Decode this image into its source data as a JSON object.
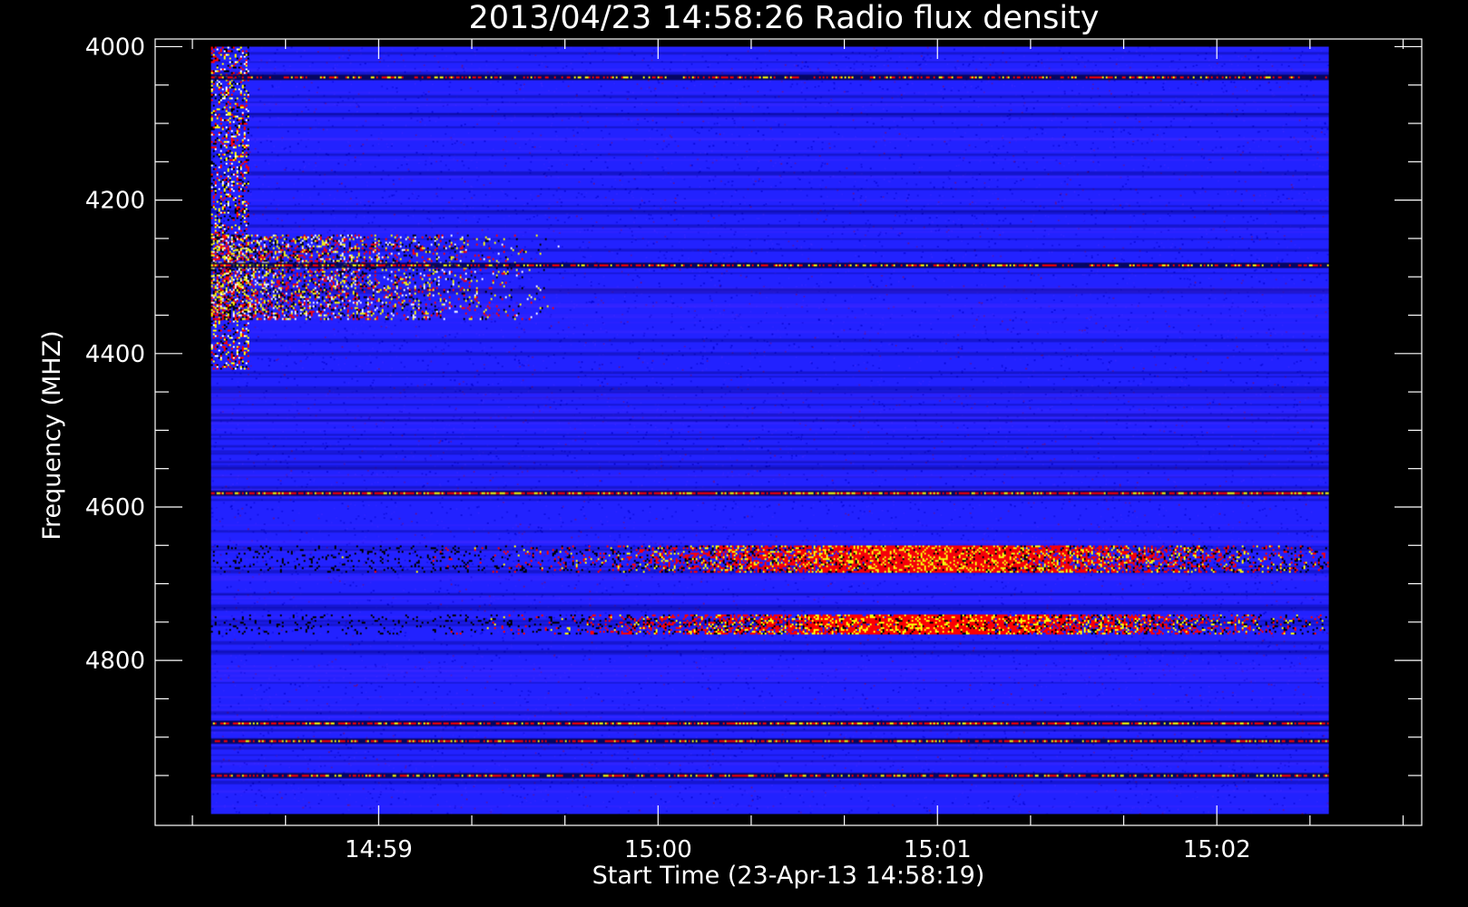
{
  "chart_data": {
    "type": "heatmap",
    "title": "2013/04/23 14:58:26 Radio flux density",
    "xlabel": "Start Time (23-Apr-13 14:58:19)",
    "ylabel": "Frequency (MHZ)",
    "x_range_seconds_after_start": [
      -7,
      265
    ],
    "x_data_extent_seconds_after_start": [
      5,
      245
    ],
    "x_ticks": [
      {
        "label": "14:59",
        "value": 41
      },
      {
        "label": "15:00",
        "value": 101
      },
      {
        "label": "15:01",
        "value": 161
      },
      {
        "label": "15:02",
        "value": 221
      }
    ],
    "y_range_mhz": [
      3990,
      5015
    ],
    "y_data_extent_mhz": [
      4000,
      5000
    ],
    "y_ticks": [
      {
        "label": "4000",
        "value": 4000
      },
      {
        "label": "4200",
        "value": 4200
      },
      {
        "label": "4400",
        "value": 4400
      },
      {
        "label": "4600",
        "value": 4600
      },
      {
        "label": "4800",
        "value": 4800
      }
    ],
    "colormap": [
      "#000000",
      "#0000ff",
      "#ff0000",
      "#ffff00",
      "#ffffff"
    ],
    "background_color": "#2222ff",
    "features": [
      {
        "name": "burst",
        "t": [
          5,
          13
        ],
        "f": [
          4000,
          4420
        ],
        "level": 0.9
      },
      {
        "name": "burst-band",
        "t": [
          5,
          80
        ],
        "f": [
          4245,
          4355
        ],
        "level": 0.7
      },
      {
        "name": "line",
        "f": 4040,
        "t": [
          5,
          245
        ],
        "level": 0.5
      },
      {
        "name": "line",
        "f": 4285,
        "t": [
          5,
          245
        ],
        "level": 0.55
      },
      {
        "name": "line",
        "f": 4582,
        "t": [
          5,
          245
        ],
        "level": 0.85
      },
      {
        "name": "band",
        "f": [
          4650,
          4685
        ],
        "t": [
          5,
          245
        ],
        "peak_t": 160,
        "level": 0.95
      },
      {
        "name": "band",
        "f": [
          4740,
          4765
        ],
        "t": [
          5,
          245
        ],
        "peak_t": 160,
        "level": 0.9
      },
      {
        "name": "line",
        "f": 4882,
        "t": [
          5,
          245
        ],
        "level": 0.75
      },
      {
        "name": "line",
        "f": 4905,
        "t": [
          5,
          245
        ],
        "level": 0.7
      },
      {
        "name": "line",
        "f": 4950,
        "t": [
          5,
          245
        ],
        "level": 0.6
      }
    ]
  }
}
